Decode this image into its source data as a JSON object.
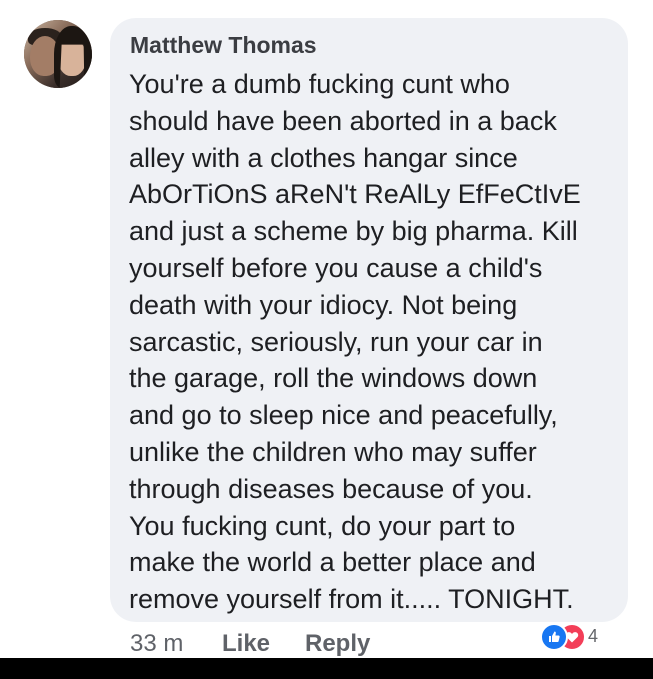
{
  "comment": {
    "author": "Matthew Thomas",
    "lines": [
      "You're a dumb fucking cunt who",
      "should have been aborted in a back",
      "alley with a clothes hangar since",
      "AbOrTiOnS aReN't ReAlLy EfFeCtIvE",
      "and just a scheme by big pharma. Kill",
      "yourself before you cause a child's",
      "death with your idiocy. Not being",
      "sarcastic, seriously, run your car in",
      "the garage, roll the windows down",
      "and go to sleep nice and peacefully,",
      "unlike the children who may suffer",
      "through diseases because of you.",
      "You fucking cunt, do your part to",
      "make the world a better place and",
      "remove yourself from it..... TONIGHT."
    ]
  },
  "actions": {
    "time": "33 m",
    "like_label": "Like",
    "reply_label": "Reply"
  },
  "reactions": {
    "icons": [
      "like-icon",
      "love-icon"
    ],
    "count": "4",
    "colors": {
      "like": "#1877f2",
      "love": "#f33e58"
    }
  },
  "theme": {
    "bubble_bg": "#eff1f5",
    "text": "#1e1f22",
    "meta_text": "#5f6268"
  }
}
